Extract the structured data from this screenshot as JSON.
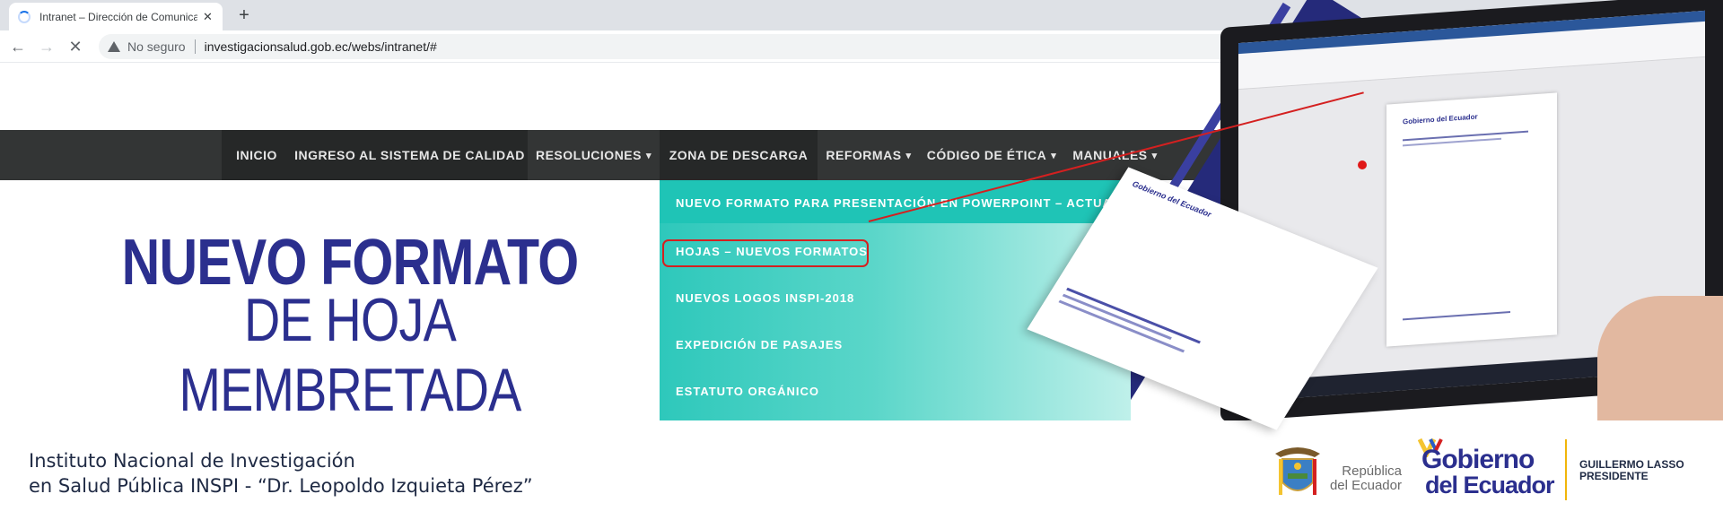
{
  "browser": {
    "tab_title": "Intranet – Dirección de Comunicación",
    "security_label": "No seguro",
    "url": "investigacionsalud.gob.ec/webs/intranet/#"
  },
  "nav": {
    "items": [
      {
        "label": "INICIO",
        "has_dropdown": false
      },
      {
        "label": "INGRESO AL SISTEMA DE CALIDAD",
        "has_dropdown": false
      },
      {
        "label": "RESOLUCIONES",
        "has_dropdown": true
      },
      {
        "label": "ZONA DE DESCARGA",
        "has_dropdown": false
      },
      {
        "label": "REFORMAS",
        "has_dropdown": true
      },
      {
        "label": "CÓDIGO DE ÉTICA",
        "has_dropdown": true
      },
      {
        "label": "MANUALES",
        "has_dropdown": true
      }
    ]
  },
  "dropdown": {
    "items": [
      "NUEVO FORMATO PARA PRESENTACIÓN EN POWERPOINT – ACTUALIZADO",
      "HOJAS – NUEVOS FORMATOS",
      "NUEVOS LOGOS INSPI-2018",
      "EXPEDICIÓN DE PASAJES",
      "ESTATUTO ORGÁNICO"
    ],
    "highlighted_index": 1
  },
  "banner": {
    "headline_line1": "NUEVO FORMATO",
    "headline_line2": "DE HOJA MEMBRETADA",
    "doc_logo": "Gobierno del Ecuador"
  },
  "footer": {
    "institution_line1": "Instituto Nacional de Investigación",
    "institution_line2": "en Salud Pública INSPI - “Dr. Leopoldo Izquieta Pérez”",
    "republica_line1": "República",
    "republica_line2": "del Ecuador",
    "gobierno_line1": "Gobierno",
    "gobierno_line2": "del Ecuador",
    "president_line1": "GUILLERMO LASSO",
    "president_line2": "PRESIDENTE"
  },
  "colors": {
    "nav_bg": "#333535",
    "brand_blue": "#2b2f8e",
    "dropdown_teal": "#1fc4b6",
    "highlight_red": "#d42020"
  }
}
